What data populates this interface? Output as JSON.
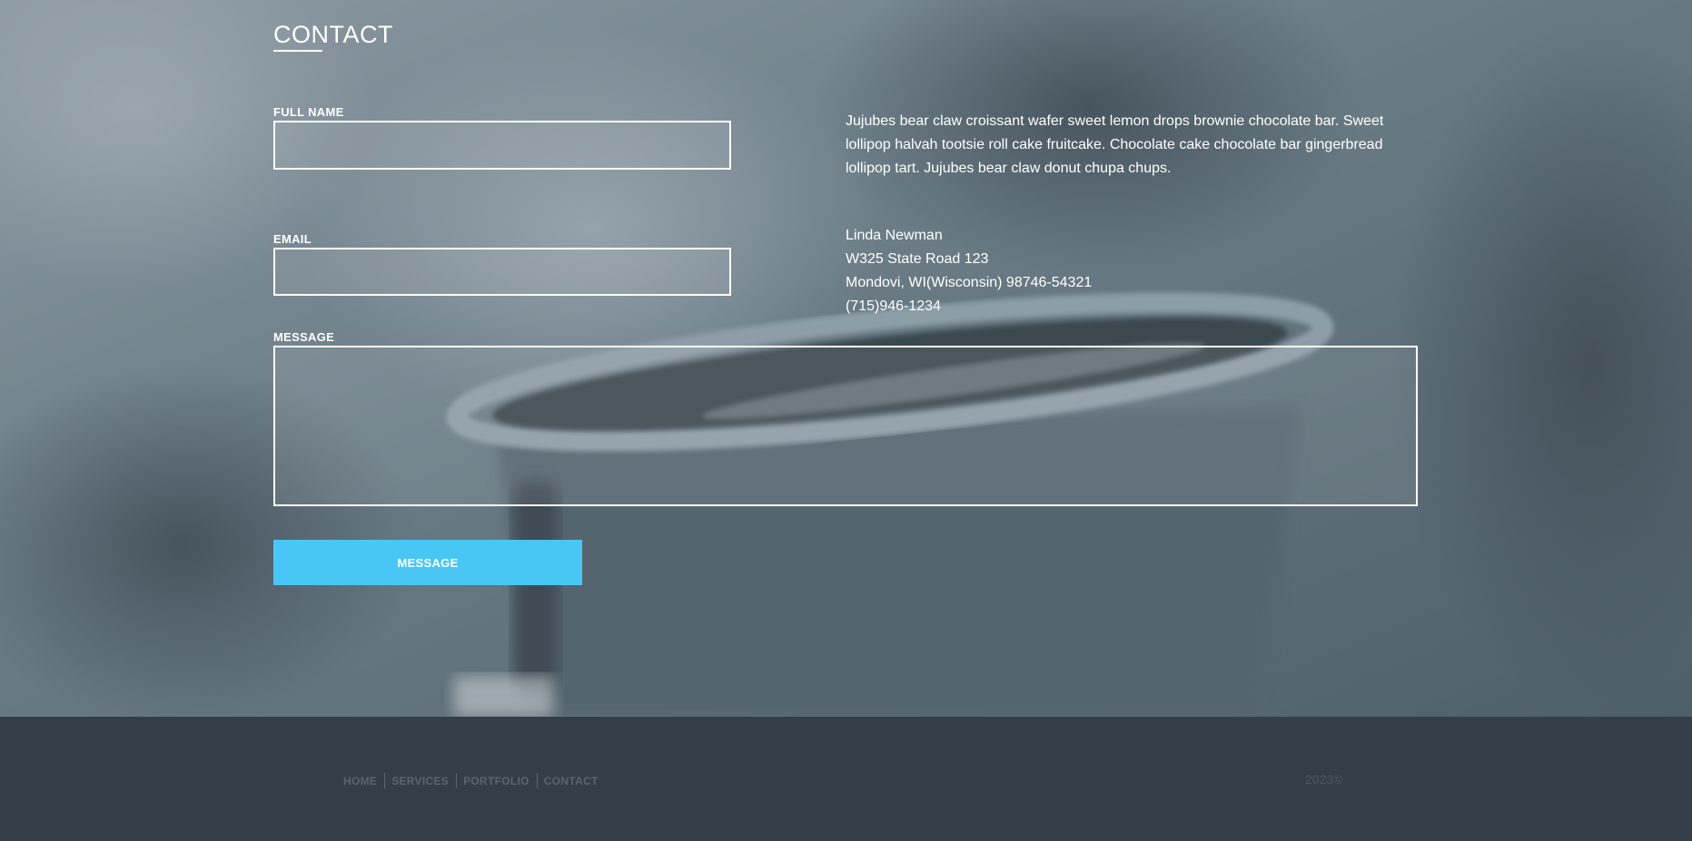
{
  "contact": {
    "title": "CONTACT",
    "full_name_label": "FULL NAME",
    "full_name_value": "",
    "email_label": "EMAIL",
    "email_value": "",
    "message_label": "MESSAGE",
    "message_value": "",
    "submit_label": "MESSAGE"
  },
  "info": {
    "description": "Jujubes bear claw croissant wafer sweet lemon drops brownie chocolate bar. Sweet lollipop halvah tootsie roll cake fruitcake. Chocolate cake chocolate bar gingerbread lollipop tart. Jujubes bear claw donut chupa chups.",
    "address_lines": [
      "Linda Newman",
      "W325 State Road 123",
      "Mondovi, WI(Wisconsin) 98746-54321",
      "(715)946-1234"
    ]
  },
  "footer": {
    "nav": [
      "HOME",
      "SERVICES",
      "PORTFOLIO",
      "CONTACT"
    ],
    "copyright": "2023©"
  },
  "colors": {
    "accent": "#48c7f5",
    "footer_bg": "#343e48",
    "footer_text": "#59666f"
  }
}
